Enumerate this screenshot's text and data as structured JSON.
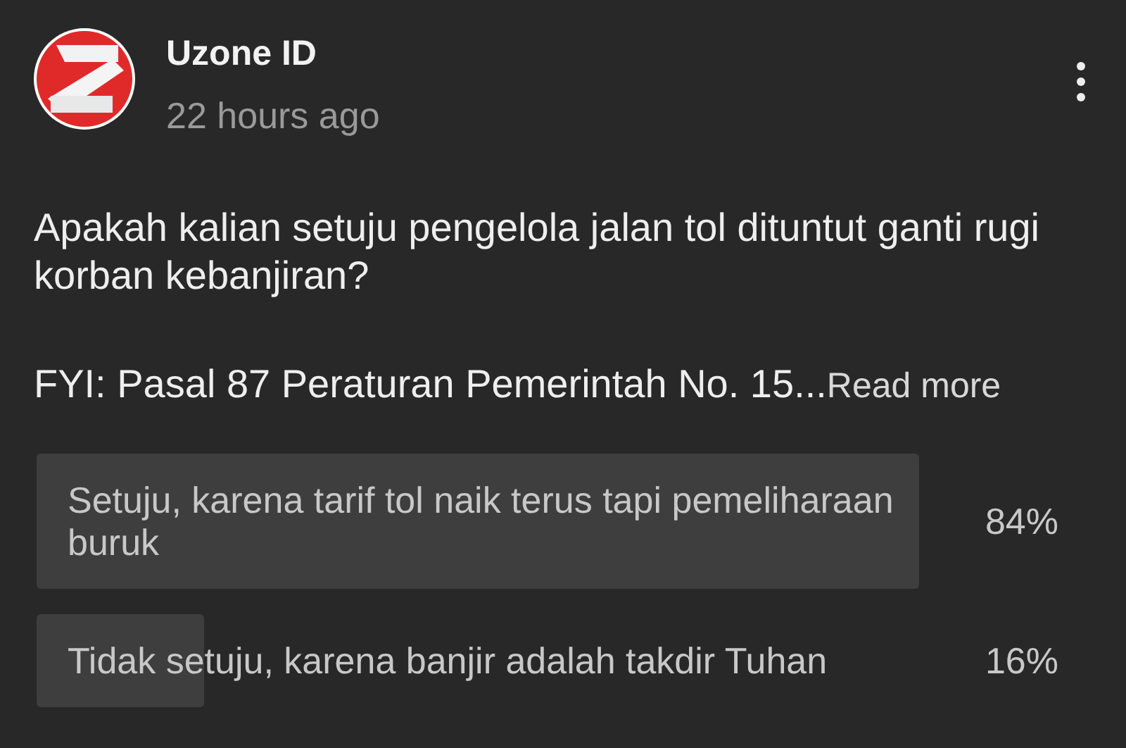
{
  "post": {
    "author": "Uzone ID",
    "time": "22 hours ago",
    "question": "Apakah kalian setuju pengelola jalan tol dituntut ganti rugi korban kebanjiran?",
    "excerpt": "FYI: Pasal 87 Peraturan Pemerintah No. 15...",
    "read_more": "Read more"
  },
  "poll": [
    {
      "label": "Setuju, karena tarif tol naik terus tapi pemeliharaan buruk",
      "percent": "84%"
    },
    {
      "label": "Tidak setuju, karena banjir adalah takdir Tuhan",
      "percent": "16%"
    }
  ]
}
